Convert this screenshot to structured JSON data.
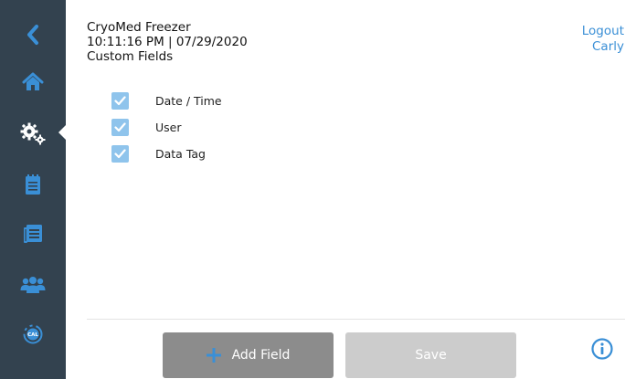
{
  "header": {
    "device_name": "CryoMed Freezer",
    "datetime": "10:11:16 PM | 07/29/2020",
    "page_title": "Custom Fields"
  },
  "user": {
    "logout_label": "Logout",
    "username": "Carly"
  },
  "sidebar": {
    "items": [
      {
        "icon": "back-chevron-icon"
      },
      {
        "icon": "home-icon"
      },
      {
        "icon": "settings-gears-icon",
        "active": true
      },
      {
        "icon": "notepad-icon"
      },
      {
        "icon": "event-log-icon"
      },
      {
        "icon": "users-icon"
      },
      {
        "icon": "calibration-icon"
      }
    ]
  },
  "custom_fields": [
    {
      "label": "Date / Time",
      "checked": true
    },
    {
      "label": "User",
      "checked": true
    },
    {
      "label": "Data Tag",
      "checked": true
    }
  ],
  "actions": {
    "add_field_label": "Add Field",
    "save_label": "Save"
  },
  "colors": {
    "sidebar_bg": "#33424f",
    "accent": "#3a8fd6",
    "checkbox": "#8fc4ec",
    "add_button": "#8c8c8c",
    "save_button_disabled": "#cccccc"
  }
}
